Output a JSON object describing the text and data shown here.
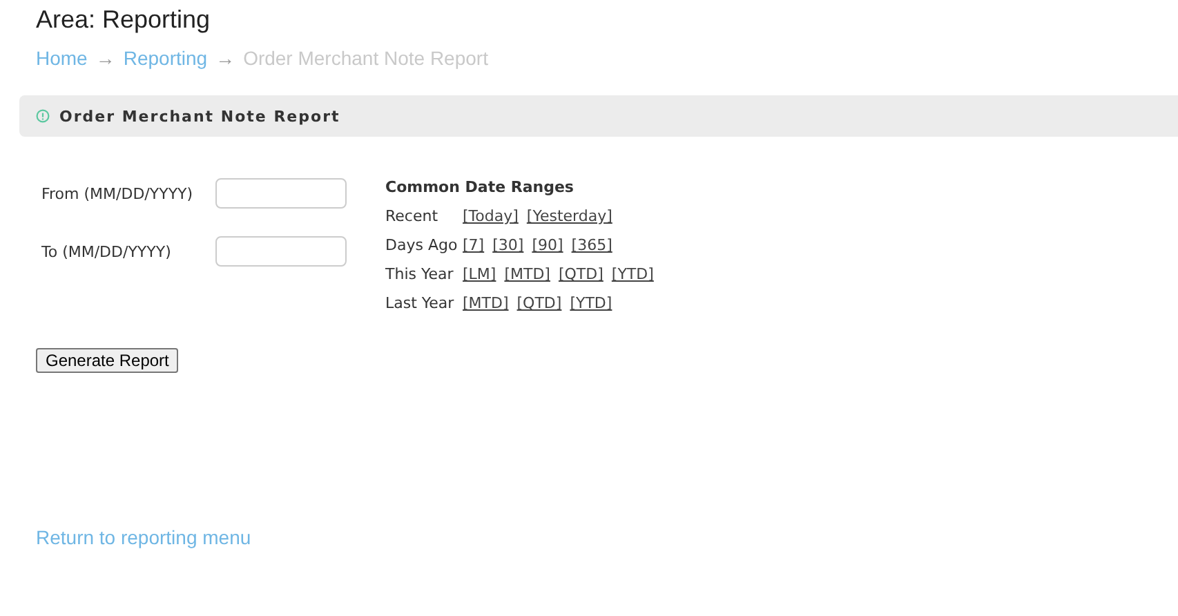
{
  "area_title": "Area: Reporting",
  "breadcrumb": [
    {
      "label": "Home",
      "kind": "link"
    },
    {
      "label": "→",
      "kind": "separator"
    },
    {
      "label": "Reporting",
      "kind": "link"
    },
    {
      "label": "→",
      "kind": "separator"
    },
    {
      "label": "Order Merchant Note Report",
      "kind": "current"
    }
  ],
  "panel": {
    "title": "Order Merchant Note Report"
  },
  "fields": [
    {
      "label": "From (MM/DD/YYYY)"
    },
    {
      "label": "To (MM/DD/YYYY)"
    }
  ],
  "date_ranges": {
    "title": "Common Date Ranges",
    "rows": [
      {
        "label": "Recent",
        "links": [
          "[Today]",
          "[Yesterday]"
        ]
      },
      {
        "label": "Days Ago",
        "links": [
          "[7]",
          "[30]",
          "[90]",
          "[365]"
        ]
      },
      {
        "label": "This Year",
        "links": [
          "[LM]",
          "[MTD]",
          "[QTD]",
          "[YTD]"
        ]
      },
      {
        "label": "Last Year",
        "links": [
          "[MTD]",
          "[QTD]",
          "[YTD]"
        ]
      }
    ]
  },
  "generate_button": "Generate Report",
  "return_link": "Return to reporting menu"
}
